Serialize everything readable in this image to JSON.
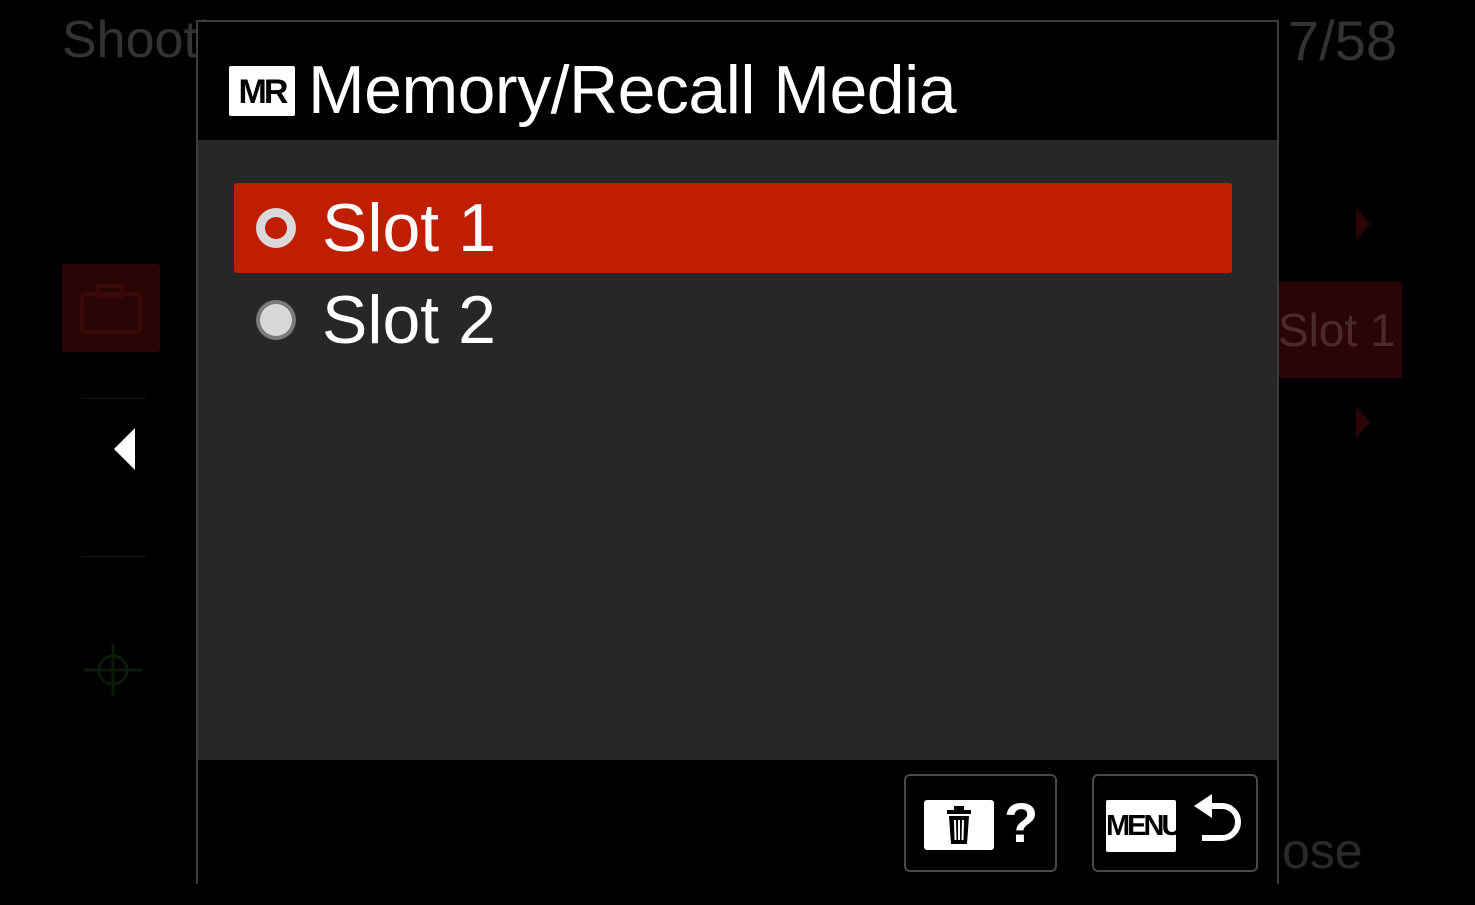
{
  "background": {
    "title": "Shooti",
    "page": "7/58",
    "slot_value": "Slot 1",
    "close_label": "ose"
  },
  "dialog": {
    "badge": "MR",
    "title": "Memory/Recall Media",
    "options": [
      {
        "label": "Slot 1",
        "selected": true
      },
      {
        "label": "Slot 2",
        "selected": false
      }
    ],
    "footer": {
      "help_symbol": "?",
      "menu_label": "MENU"
    }
  },
  "colors": {
    "selection": "#c01e00",
    "body": "#272727",
    "header": "#000000"
  },
  "icons": [
    "left-arrow-icon",
    "radio-icon",
    "trash-icon",
    "help-icon",
    "back-arrow-icon"
  ]
}
